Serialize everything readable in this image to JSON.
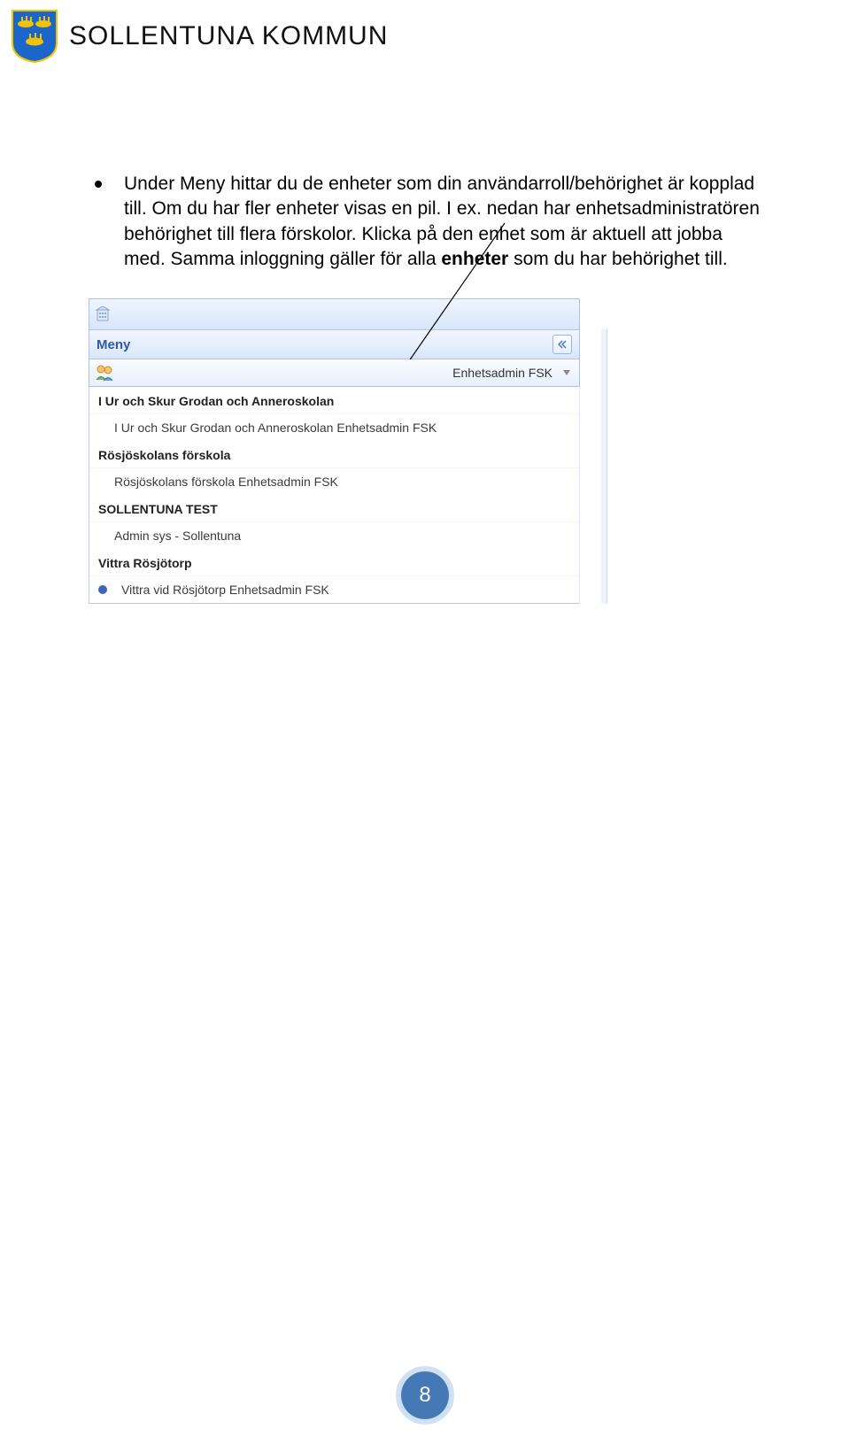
{
  "header": {
    "org": "SOLLENTUNA KOMMUN"
  },
  "bullet": {
    "line1_a": "Under Meny hittar du de enheter som din användarroll/behörighet är kopplad till.",
    "line2_a": "Om du har fler enheter visas en pil. I ex. nedan har enhetsadministratören",
    "line3_a": "behörighet till flera förskolor. Klicka på den enhet som är aktuell att jobba med.",
    "line4_a": "Samma inloggning gäller för alla ",
    "line4_b_strong": "enheter",
    "line4_c": " som du har behörighet till."
  },
  "app": {
    "menu_title": "Meny",
    "role_label": "Enhetsadmin FSK",
    "groups": [
      {
        "name": "I Ur och Skur Grodan och Anneroskolan",
        "items": [
          {
            "label": "I Ur och Skur Grodan och Anneroskolan Enhetsadmin FSK",
            "current": false
          }
        ]
      },
      {
        "name": "Rösjöskolans förskola",
        "items": [
          {
            "label": "Rösjöskolans förskola Enhetsadmin FSK",
            "current": false
          }
        ]
      },
      {
        "name": "SOLLENTUNA TEST",
        "items": [
          {
            "label": "Admin sys - Sollentuna",
            "current": false
          }
        ]
      },
      {
        "name": "Vittra Rösjötorp",
        "items": [
          {
            "label": "Vittra vid Rösjötorp Enhetsadmin FSK",
            "current": true
          }
        ]
      }
    ]
  },
  "page_number": "8"
}
